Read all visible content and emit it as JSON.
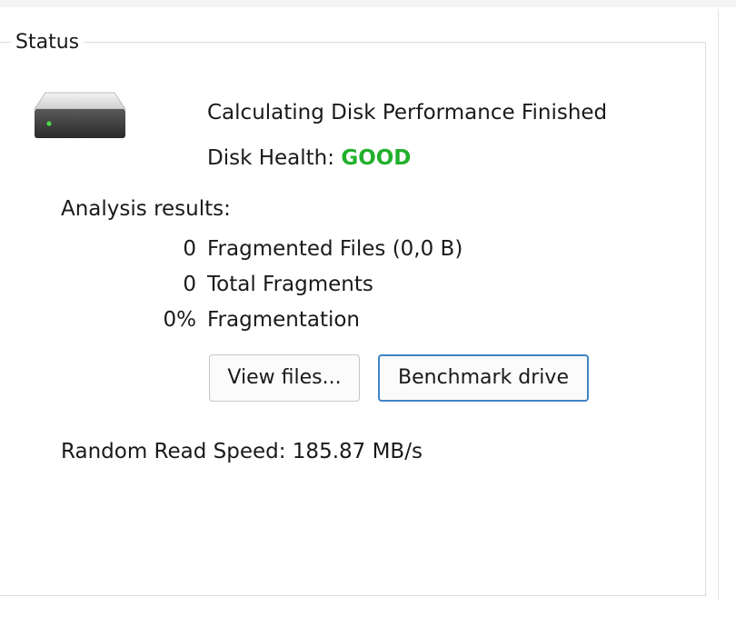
{
  "status_group": {
    "legend": "Status"
  },
  "drive": {
    "icon": "hard-drive-icon",
    "status_text": "Calculating Disk Performance Finished",
    "health_label": "Disk Health:",
    "health_value": "GOOD",
    "health_color": "#22b02c"
  },
  "analysis": {
    "label": "Analysis results:",
    "rows": [
      {
        "value": "0",
        "label": "Fragmented Files (0,0 B)"
      },
      {
        "value": "0",
        "label": "Total Fragments"
      },
      {
        "value": "0%",
        "label": "Fragmentation"
      }
    ]
  },
  "buttons": {
    "view_files": "View files...",
    "benchmark": "Benchmark drive"
  },
  "speed": {
    "text": "Random Read Speed: 185.87 MB/s"
  }
}
